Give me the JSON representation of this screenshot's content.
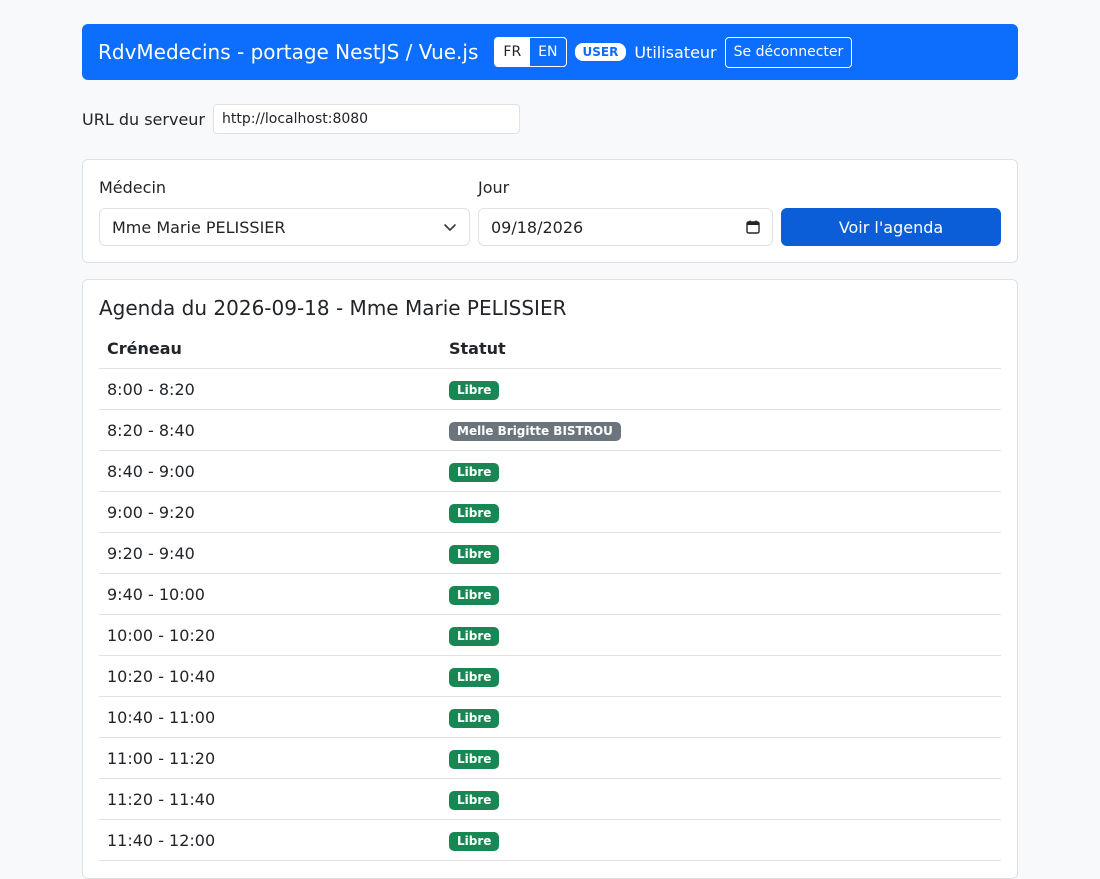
{
  "navbar": {
    "brand": "RdvMedecins - portage NestJS / Vue.js",
    "lang_fr": "FR",
    "lang_en": "EN",
    "role_badge": "USER",
    "user_name": "Utilisateur",
    "logout_label": "Se déconnecter"
  },
  "server": {
    "label": "URL du serveur",
    "value": "http://localhost:8080"
  },
  "form": {
    "doctor_label": "Médecin",
    "doctor_selected": "Mme Marie PELISSIER",
    "day_label": "Jour",
    "day_value": "09/18/2026",
    "submit_label": "Voir l'agenda"
  },
  "agenda": {
    "title": "Agenda du 2026-09-18 - Mme Marie PELISSIER",
    "col_slot": "Créneau",
    "col_status": "Statut",
    "rows": [
      {
        "slot": "8:00 - 8:20",
        "status": "Libre",
        "booked": false
      },
      {
        "slot": "8:20 - 8:40",
        "status": "Melle Brigitte BISTROU",
        "booked": true
      },
      {
        "slot": "8:40 - 9:00",
        "status": "Libre",
        "booked": false
      },
      {
        "slot": "9:00 - 9:20",
        "status": "Libre",
        "booked": false
      },
      {
        "slot": "9:20 - 9:40",
        "status": "Libre",
        "booked": false
      },
      {
        "slot": "9:40 - 10:00",
        "status": "Libre",
        "booked": false
      },
      {
        "slot": "10:00 - 10:20",
        "status": "Libre",
        "booked": false
      },
      {
        "slot": "10:20 - 10:40",
        "status": "Libre",
        "booked": false
      },
      {
        "slot": "10:40 - 11:00",
        "status": "Libre",
        "booked": false
      },
      {
        "slot": "11:00 - 11:20",
        "status": "Libre",
        "booked": false
      },
      {
        "slot": "11:20 - 11:40",
        "status": "Libre",
        "booked": false
      },
      {
        "slot": "11:40 - 12:00",
        "status": "Libre",
        "booked": false
      }
    ]
  },
  "colors": {
    "primary": "#0d6efd",
    "free_badge": "#198754",
    "booked_badge": "#6c757d"
  }
}
